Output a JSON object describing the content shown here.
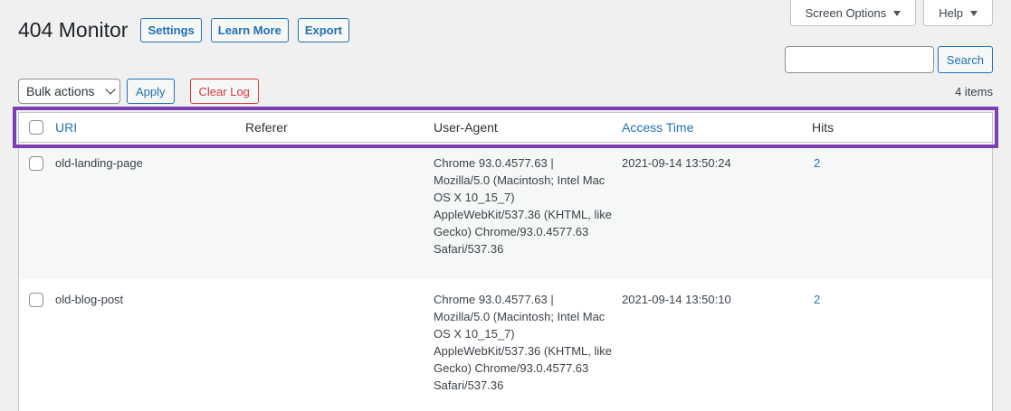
{
  "meta_tabs": {
    "screen_options": "Screen Options",
    "help": "Help"
  },
  "header": {
    "title": "404 Monitor",
    "buttons": [
      "Settings",
      "Learn More",
      "Export"
    ]
  },
  "search": {
    "value": "",
    "button": "Search"
  },
  "tablenav": {
    "bulk_actions": "Bulk actions",
    "apply": "Apply",
    "clear_log": "Clear Log",
    "items_count": "4 items"
  },
  "table": {
    "columns": [
      "URI",
      "Referer",
      "User-Agent",
      "Access Time",
      "Hits"
    ],
    "rows": [
      {
        "uri": "old-landing-page",
        "referer": "",
        "user_agent": "Chrome 93.0.4577.63 | Mozilla/5.0 (Macintosh; Intel Mac OS X 10_15_7) AppleWebKit/537.36 (KHTML, like Gecko) Chrome/93.0.4577.63 Safari/537.36",
        "access_time": "2021-09-14 13:50:24",
        "hits": "2"
      },
      {
        "uri": "old-blog-post",
        "referer": "",
        "user_agent": "Chrome 93.0.4577.63 | Mozilla/5.0 (Macintosh; Intel Mac OS X 10_15_7) AppleWebKit/537.36 (KHTML, like Gecko) Chrome/93.0.4577.63 Safari/537.36",
        "access_time": "2021-09-14 13:50:10",
        "hits": "2"
      }
    ]
  },
  "colors": {
    "accent": "#2271b1",
    "danger": "#d63638",
    "highlight": "#7c3fb3"
  }
}
